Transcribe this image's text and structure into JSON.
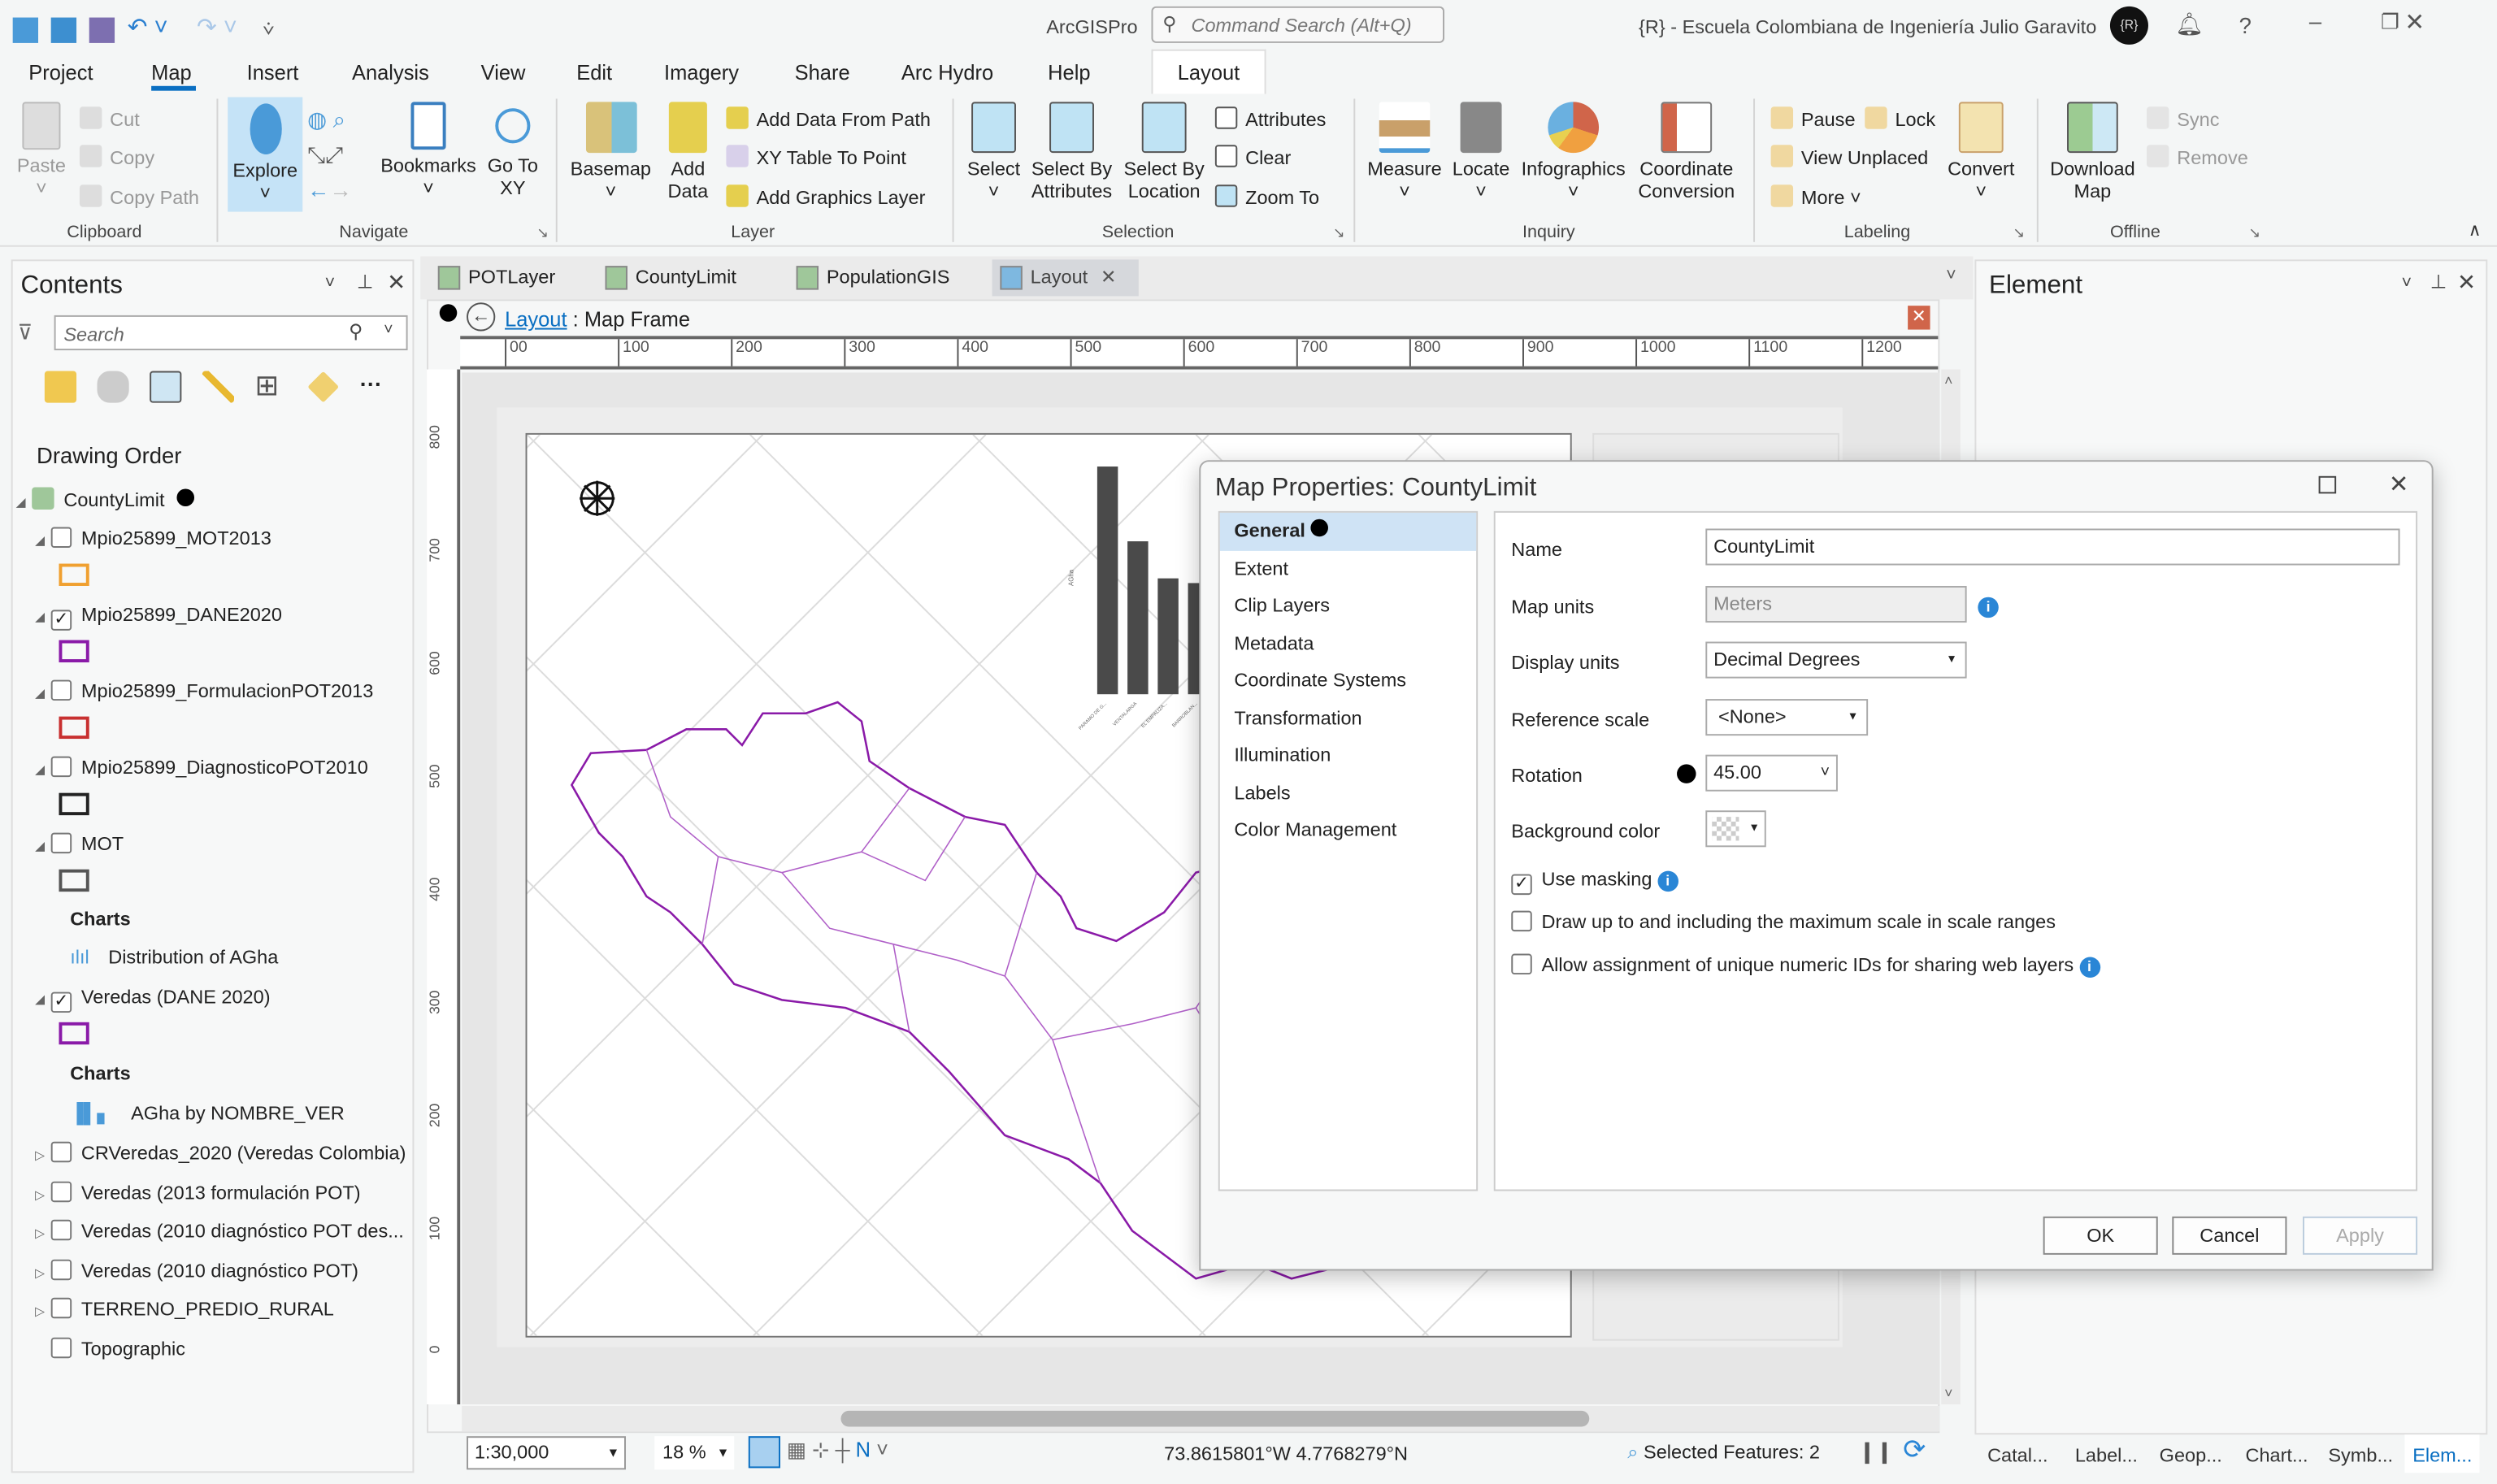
{
  "titlebar": {
    "app": "ArcGISPro",
    "search_placeholder": "Command Search (Alt+Q)",
    "org": "{R} - Escuela Colombiana de Ingeniería Julio Garavito",
    "avatar": "{R}"
  },
  "menu": [
    "Project",
    "Map",
    "Insert",
    "Analysis",
    "View",
    "Edit",
    "Imagery",
    "Share",
    "Arc Hydro",
    "Help",
    "Layout"
  ],
  "ribbon": {
    "clipboard": {
      "label": "Clipboard",
      "paste": "Paste",
      "cut": "Cut",
      "copy": "Copy",
      "copy_path": "Copy Path"
    },
    "navigate": {
      "label": "Navigate",
      "explore": "Explore",
      "bookmarks": "Bookmarks",
      "go_to_xy": "Go To XY"
    },
    "layer": {
      "label": "Layer",
      "basemap": "Basemap",
      "add_data": "Add Data",
      "add_data_from_path": "Add Data From Path",
      "xy_table": "XY Table To Point",
      "add_graphics": "Add Graphics Layer"
    },
    "selection": {
      "label": "Selection",
      "select": "Select",
      "select_by_attributes": "Select By Attributes",
      "select_by_location": "Select By Location",
      "attributes": "Attributes",
      "clear": "Clear",
      "zoom_to": "Zoom To"
    },
    "inquiry": {
      "label": "Inquiry",
      "measure": "Measure",
      "locate": "Locate",
      "infographics": "Infographics",
      "coordinate_conversion": "Coordinate Conversion"
    },
    "labeling": {
      "label": "Labeling",
      "pause": "Pause",
      "lock": "Lock",
      "view_unplaced": "View Unplaced",
      "more": "More",
      "convert": "Convert"
    },
    "offline": {
      "label": "Offline",
      "download_map": "Download Map",
      "sync": "Sync",
      "remove": "Remove"
    }
  },
  "contents": {
    "title": "Contents",
    "search_placeholder": "Search",
    "drawing_order": "Drawing Order",
    "root": "CountyLimit",
    "layers": [
      {
        "name": "Mpio25899_MOT2013",
        "checked": false,
        "color": "#f0a030"
      },
      {
        "name": "Mpio25899_DANE2020",
        "checked": true,
        "color": "#8a1aa8"
      },
      {
        "name": "Mpio25899_FormulacionPOT2013",
        "checked": false,
        "color": "#c83030"
      },
      {
        "name": "Mpio25899_DiagnosticoPOT2010",
        "checked": false,
        "color": "#222222"
      },
      {
        "name": "MOT",
        "checked": false,
        "color": "#555555"
      }
    ],
    "charts_label": "Charts",
    "chart1": "Distribution of AGha",
    "veredas": "Veredas (DANE 2020)",
    "chart2": "AGha by NOMBRE_VER",
    "others": [
      "CRVeredas_2020 (Veredas Colombia)",
      "Veredas (2013 formulación POT)",
      "Veredas (2010 diagnóstico POT des...",
      "Veredas (2010 diagnóstico POT)",
      "TERRENO_PREDIO_RURAL",
      "Topographic"
    ]
  },
  "doc_tabs": [
    "POTLayer",
    "CountyLimit",
    "PopulationGIS",
    "Layout"
  ],
  "layout": {
    "breadcrumb_link": "Layout",
    "breadcrumb_rest": ": Map Frame",
    "ruler_h": [
      "00",
      "100",
      "200",
      "300",
      "400",
      "500",
      "600",
      "700",
      "800",
      "900",
      "1000",
      "1100",
      "1200"
    ],
    "ruler_v": [
      "800",
      "700",
      "600",
      "500",
      "400",
      "300",
      "200",
      "100",
      "0"
    ]
  },
  "map_chart": {
    "type": "bar",
    "ylabel": "AGha",
    "categories": [
      "PARAMO DE G...",
      "VENTALARGA",
      "EL EMPALIZA...",
      "BARROBLAN..."
    ],
    "values": [
      3380,
      2270,
      1720,
      1650
    ],
    "ylim": [
      0,
      3300
    ]
  },
  "dialog": {
    "title": "Map Properties: CountyLimit",
    "nav": [
      "General",
      "Extent",
      "Clip Layers",
      "Metadata",
      "Coordinate Systems",
      "Transformation",
      "Illumination",
      "Labels",
      "Color Management"
    ],
    "name_label": "Name",
    "name_value": "CountyLimit",
    "map_units_label": "Map units",
    "map_units_value": "Meters",
    "display_units_label": "Display units",
    "display_units_value": "Decimal Degrees",
    "ref_scale_label": "Reference scale",
    "ref_scale_value": "<None>",
    "rotation_label": "Rotation",
    "rotation_value": "45.00",
    "bg_label": "Background color",
    "use_masking": "Use masking",
    "use_masking_checked": true,
    "draw_up": "Draw up to and including the maximum scale in scale ranges",
    "allow_ids": "Allow assignment of unique numeric IDs for sharing web layers",
    "ok": "OK",
    "cancel": "Cancel",
    "apply": "Apply"
  },
  "element": {
    "title": "Element",
    "tabs": [
      "Catal...",
      "Label...",
      "Geop...",
      "Chart...",
      "Symb...",
      "Elem..."
    ]
  },
  "status": {
    "scale": "1:30,000",
    "zoom": "18 %",
    "coords": "73.8615801°W 4.7768279°N",
    "selected": "Selected Features: 2"
  }
}
